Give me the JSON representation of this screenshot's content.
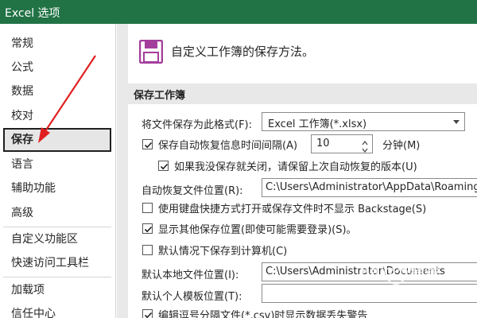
{
  "window": {
    "title": "Excel 选项"
  },
  "sidebar": {
    "items": [
      {
        "label": "常规"
      },
      {
        "label": "公式"
      },
      {
        "label": "数据"
      },
      {
        "label": "校对"
      },
      {
        "label": "保存"
      },
      {
        "label": "语言"
      },
      {
        "label": "辅助功能"
      },
      {
        "label": "高级"
      },
      {
        "label": "自定义功能区"
      },
      {
        "label": "快速访问工具栏"
      },
      {
        "label": "加载项"
      },
      {
        "label": "信任中心"
      }
    ],
    "selected": "保存"
  },
  "content": {
    "header": "自定义工作簿的保存方法。",
    "header_icon": "save-floppy-icon",
    "section_title": "保存工作簿",
    "save_format": {
      "label": "将文件保存为此格式(F):",
      "value": "Excel 工作簿(*.xlsx)"
    },
    "autorecover_interval": {
      "label": "保存自动恢复信息时间间隔(A)",
      "value": "10",
      "unit": "分钟(M)",
      "checked": true
    },
    "keep_last_autorecover": {
      "label": "如果我没保存就关闭，请保留上次自动恢复的版本(U)",
      "checked": true
    },
    "autorecover_location": {
      "label": "自动恢复文件位置(R):",
      "value": "C:\\Users\\Administrator\\AppData\\Roaming"
    },
    "no_backstage": {
      "label": "使用键盘快捷方式打开或保存文件时不显示 Backstage(S)",
      "checked": false
    },
    "show_additional_places": {
      "label": "显示其他保存位置(即使可能需要登录)(S)。",
      "checked": true
    },
    "default_save_to_computer": {
      "label": "默认情况下保存到计算机(C)",
      "checked": false
    },
    "default_local_location": {
      "label": "默认本地文件位置(I):",
      "value": "C:\\Users\\Administrator\\Documents"
    },
    "default_template_location": {
      "label": "默认个人模板位置(T):",
      "value": ""
    },
    "csv_warning": {
      "label": "编辑逗号分隔文件(*.csv)时显示数据丢失警告",
      "checked": true
    }
  },
  "colors": {
    "titlebar": "#217346",
    "annotation_arrow": "#e02020",
    "icon_purple": "#a43e9c"
  },
  "annotation": "red-arrow-pointing-to-save"
}
